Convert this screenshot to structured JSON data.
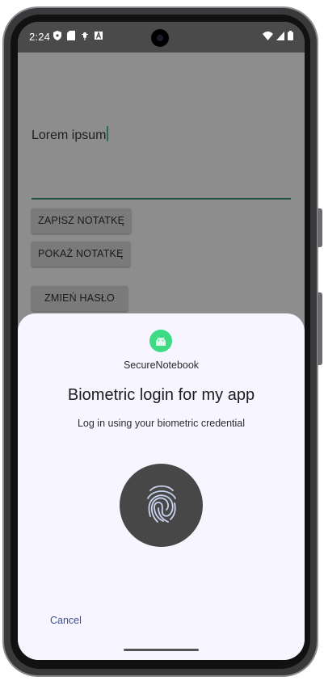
{
  "status_bar": {
    "time": "2:24",
    "left_icons": [
      "shield-icon",
      "sd-card-icon",
      "android-debug-icon",
      "a-icon"
    ],
    "right_icons": [
      "wifi-icon",
      "signal-icon",
      "battery-icon"
    ]
  },
  "app": {
    "note_value": "Lorem ipsum",
    "buttons": {
      "save": "ZAPISZ NOTATKĘ",
      "show": "POKAŻ NOTATKĘ",
      "change_password": "ZMIEŃ HASŁO"
    }
  },
  "biometric_dialog": {
    "app_name": "SecureNotebook",
    "title": "Biometric login for my app",
    "subtitle": "Log in using your biometric credential",
    "icon": "fingerprint-icon",
    "cancel_label": "Cancel"
  },
  "colors": {
    "accent": "#1f5147",
    "dialog_bg": "#f7f5ff",
    "fingerprint_bg": "#474747",
    "android_green": "#3ddc84",
    "cancel_text": "#3d4f8c"
  }
}
